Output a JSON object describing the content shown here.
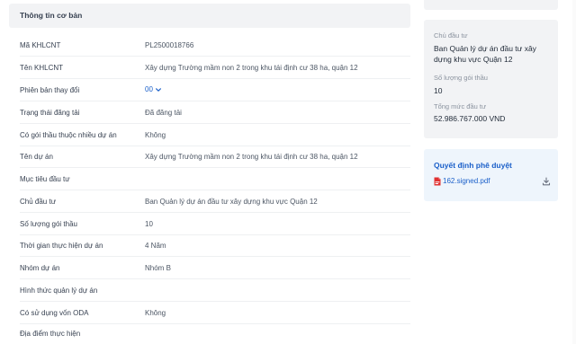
{
  "section": {
    "title": "Thông tin cơ bản"
  },
  "rows": [
    {
      "label": "Mã KHLCNT",
      "value": "PL2500018766"
    },
    {
      "label": "Tên KHLCNT",
      "value": "Xây dựng Trường mầm non 2 trong khu tái định cư 38 ha, quận 12"
    },
    {
      "label": "Phiên bản thay đổi",
      "value": "00"
    },
    {
      "label": "Trạng thái đăng tải",
      "value": "Đã đăng tải"
    },
    {
      "label": "Có gói thầu thuộc nhiều dự án",
      "value": "Không"
    },
    {
      "label": "Tên dự án",
      "value": "Xây dựng Trường mầm non 2 trong khu tái định cư 38 ha, quận 12"
    },
    {
      "label": "Mục tiêu đầu tư",
      "value": ""
    },
    {
      "label": "Chủ đầu tư",
      "value": "Ban Quản lý dự án đầu tư xây dựng khu vực Quận 12"
    },
    {
      "label": "Số lượng gói thầu",
      "value": "10"
    },
    {
      "label": "Thời gian thực hiện dự án",
      "value": "4 Năm"
    },
    {
      "label": "Nhóm dự án",
      "value": "Nhóm B"
    },
    {
      "label": "Hình thức quản lý dự án",
      "value": ""
    },
    {
      "label": "Có sử dụng vốn ODA",
      "value": "Không"
    },
    {
      "label": "Địa điểm thực hiện",
      "value": ""
    }
  ],
  "summary": {
    "investor_label": "Chủ đầu tư",
    "investor_value": "Ban Quản lý dự án đầu tư xây dựng khu vực Quận 12",
    "packages_label": "Số lượng gói thầu",
    "packages_value": "10",
    "total_label": "Tổng mức đầu tư",
    "total_value": "52.986.767.000 VND"
  },
  "decision": {
    "title": "Quyết định phê duyệt",
    "file_name": "162.signed.pdf",
    "file_icon": "pdf-icon",
    "download_icon": "download-icon"
  },
  "colors": {
    "accent": "#1a5fc9",
    "panel_bg": "#f2f3f5",
    "decision_bg": "#eef5fc",
    "pdf_red": "#e03131"
  }
}
